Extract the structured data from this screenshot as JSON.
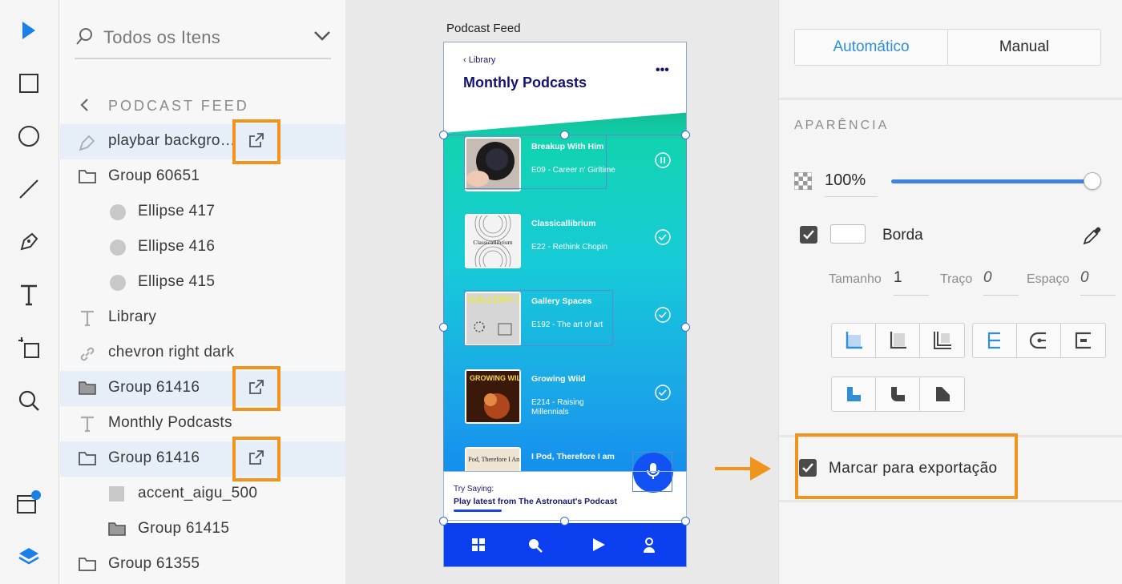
{
  "layers": {
    "search_placeholder": "Todos os Itens",
    "breadcrumb": "PODCAST FEED",
    "rows": [
      {
        "label": "playbar backgro…",
        "icon": "pen-icon"
      },
      {
        "label": "Group 60651",
        "icon": "folder-icon"
      },
      {
        "label": "Ellipse 417",
        "icon": "ellipse-icon"
      },
      {
        "label": "Ellipse 416",
        "icon": "ellipse-icon"
      },
      {
        "label": "Ellipse 415",
        "icon": "ellipse-icon"
      },
      {
        "label": "Library",
        "icon": "text-icon"
      },
      {
        "label": "chevron right dark",
        "icon": "link-icon"
      },
      {
        "label": "Group 61416",
        "icon": "folder-filled-icon"
      },
      {
        "label": "Monthly Podcasts",
        "icon": "text-icon"
      },
      {
        "label": "Group 61416",
        "icon": "folder-icon"
      },
      {
        "label": "accent_aigu_500",
        "icon": "square-icon"
      },
      {
        "label": "Group 61415",
        "icon": "folder-filled-icon"
      },
      {
        "label": "Group 61355",
        "icon": "folder-icon"
      }
    ]
  },
  "canvas": {
    "artboard_title": "Podcast Feed",
    "back_label": "Library",
    "title": "Monthly Podcasts",
    "more": "•••",
    "episodes": [
      {
        "title": "Breakup With Him",
        "subtitle": "E09 - Career n' Girltime",
        "status": "pause-icon"
      },
      {
        "title": "Classicallibrium",
        "subtitle": "E22 - Rethink Chopin",
        "status": "check-icon",
        "art_text": "Classicallibrium"
      },
      {
        "title": "Gallery Spaces",
        "subtitle": "E192 - The art of art",
        "status": "check-icon",
        "art_text": "GALLERY SPACES"
      },
      {
        "title": "Growing Wild",
        "subtitle": "E214 - Raising Millennials",
        "status": "check-icon",
        "art_text": "GROWING WILD"
      },
      {
        "title": "I Pod, Therefore I am",
        "subtitle": "",
        "status": "",
        "art_text": "I Pod, Therefore I Am"
      }
    ],
    "try_saying": "Try Saying:",
    "try_phrase": "Play latest from The Astronaut's Podcast"
  },
  "props": {
    "mode_auto": "Automático",
    "mode_manual": "Manual",
    "section": "APARÊNCIA",
    "opacity": "100%",
    "opacity_level": 1.0,
    "border_label": "Borda",
    "size_label": "Tamanho",
    "size_value": "1",
    "stroke_label": "Traço",
    "stroke_value": "0",
    "gap_label": "Espaço",
    "gap_value": "0",
    "export_label": "Marcar para exportação"
  },
  "colors": {
    "highlight": "#f0941e",
    "accent": "#2e8fd8",
    "nav": "#0c3ff0"
  }
}
